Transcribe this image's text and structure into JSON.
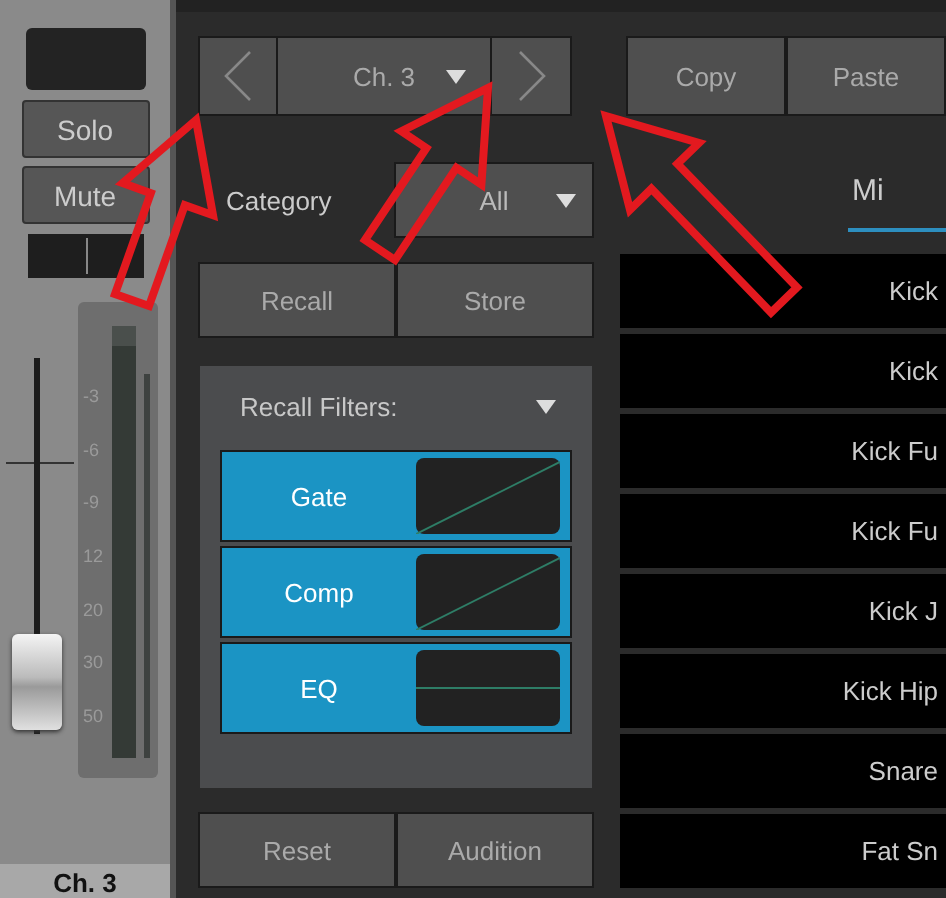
{
  "channel_strip": {
    "solo": "Solo",
    "mute": "Mute",
    "fader": {
      "level": 0.14
    },
    "meter_scale": [
      "-3",
      "-6",
      "-9",
      "12",
      "20",
      "30",
      "50"
    ],
    "name": "Ch. 3"
  },
  "channel_nav": {
    "channel": "Ch. 3"
  },
  "clipboard": [
    "Copy",
    "Paste"
  ],
  "category": {
    "label": "Category",
    "value": "All"
  },
  "tabs": [
    {
      "label": "Mi",
      "selected": true
    }
  ],
  "preset_actions": [
    "Recall",
    "Store"
  ],
  "recall_filters": {
    "title": "Recall Filters:",
    "filters": [
      {
        "label": "Gate",
        "kind": "ramp",
        "on": true
      },
      {
        "label": "Comp",
        "kind": "ramp",
        "on": true
      },
      {
        "label": "EQ",
        "kind": "flat",
        "on": true
      }
    ]
  },
  "bottom_actions": [
    "Reset",
    "Audition"
  ],
  "presets": [
    "Kick",
    "Kick",
    "Kick Fu",
    "Kick Fu",
    "Kick J",
    "Kick Hip",
    "Snare",
    "Fat Sn"
  ]
}
